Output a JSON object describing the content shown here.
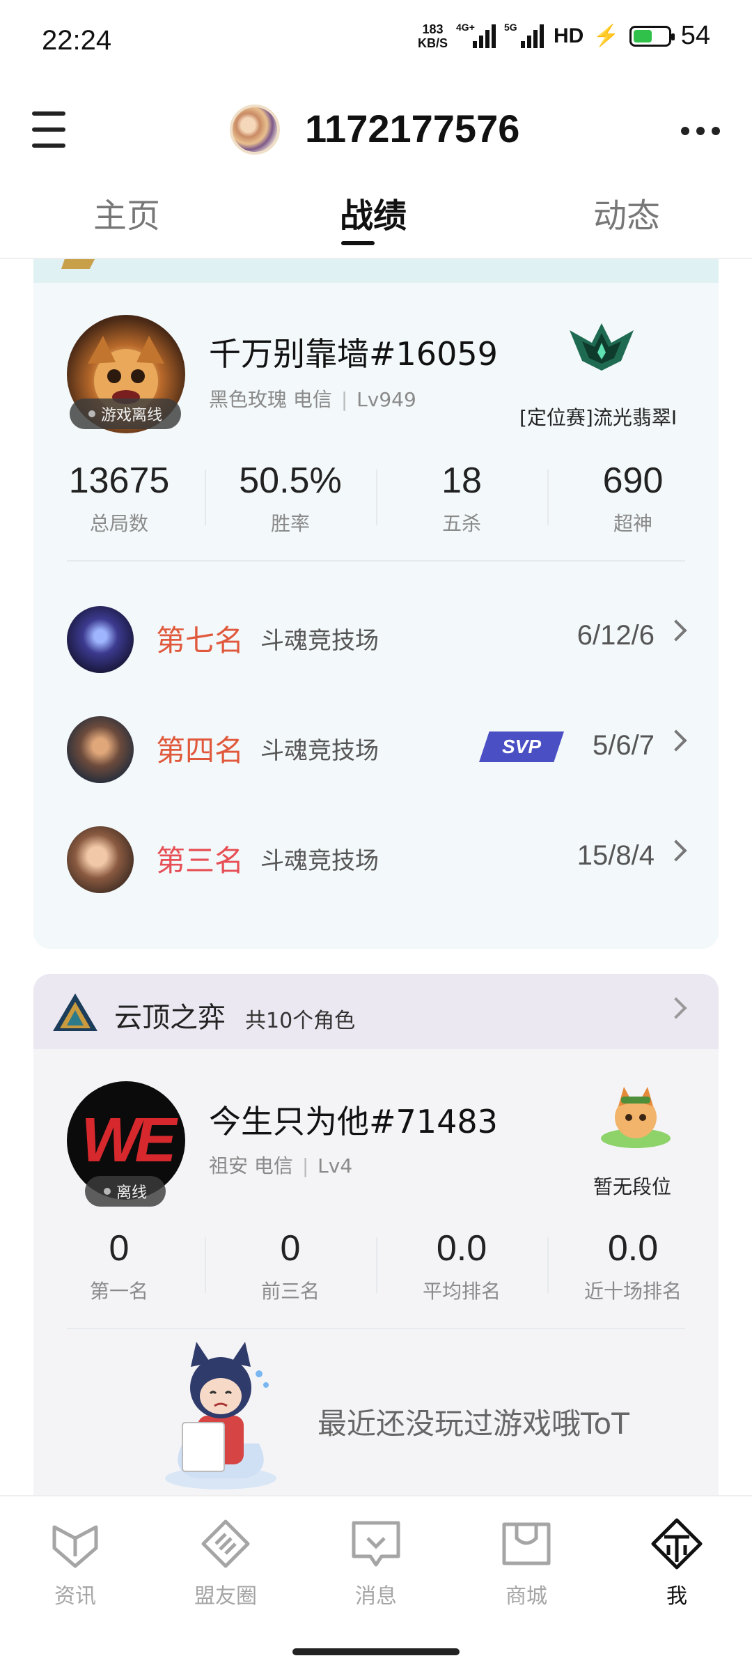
{
  "status_bar": {
    "time": "22:24",
    "net_speed_value": "183",
    "net_speed_unit": "KB/S",
    "signal1_tag": "4G+",
    "signal2_tag": "5G",
    "hd": "HD",
    "battery_percent": "54",
    "battery_level": 0.54
  },
  "header": {
    "account_id": "1172177576"
  },
  "tabs": [
    {
      "label": "主页",
      "active": false
    },
    {
      "label": "战绩",
      "active": true
    },
    {
      "label": "动态",
      "active": false
    }
  ],
  "lol_card": {
    "player_name": "千万别靠墙#16059",
    "server": "黑色玫瑰 电信",
    "level": "Lv949",
    "status": "游戏离线",
    "rank_label": "[定位赛]流光翡翠I",
    "stats": [
      {
        "value": "13675",
        "label": "总局数"
      },
      {
        "value": "50.5%",
        "label": "胜率"
      },
      {
        "value": "18",
        "label": "五杀"
      },
      {
        "value": "690",
        "label": "超神"
      }
    ],
    "matches": [
      {
        "placement": "第七名",
        "mode": "斗魂竞技场",
        "kda": "6/12/6",
        "badge": ""
      },
      {
        "placement": "第四名",
        "mode": "斗魂竞技场",
        "kda": "5/6/7",
        "badge": "SVP"
      },
      {
        "placement": "第三名",
        "mode": "斗魂竞技场",
        "kda": "15/8/4",
        "badge": ""
      }
    ]
  },
  "tft_card": {
    "title": "云顶之弈",
    "role_count": "共10个角色",
    "player_name": "今生只为他#71483",
    "server": "祖安 电信",
    "level": "Lv4",
    "status": "离线",
    "rank_label": "暂无段位",
    "stats": [
      {
        "value": "0",
        "label": "第一名"
      },
      {
        "value": "0",
        "label": "前三名"
      },
      {
        "value": "0.0",
        "label": "平均排名"
      },
      {
        "value": "0.0",
        "label": "近十场排名"
      }
    ],
    "empty_text": "最近还没玩过游戏哦ToT"
  },
  "bottom_nav": [
    {
      "label": "资讯",
      "icon": "news-icon",
      "active": false
    },
    {
      "label": "盟友圈",
      "icon": "allies-icon",
      "active": false
    },
    {
      "label": "消息",
      "icon": "message-icon",
      "active": false
    },
    {
      "label": "商城",
      "icon": "shop-icon",
      "active": false
    },
    {
      "label": "我",
      "icon": "me-icon",
      "active": true
    }
  ],
  "colors": {
    "placement_orange": "#e0593c",
    "placement_red": "#e64f55",
    "svp": "#4a4fc4",
    "card_bg": "#f3f8fa",
    "tft_head_bg": "#ebe8f1"
  }
}
